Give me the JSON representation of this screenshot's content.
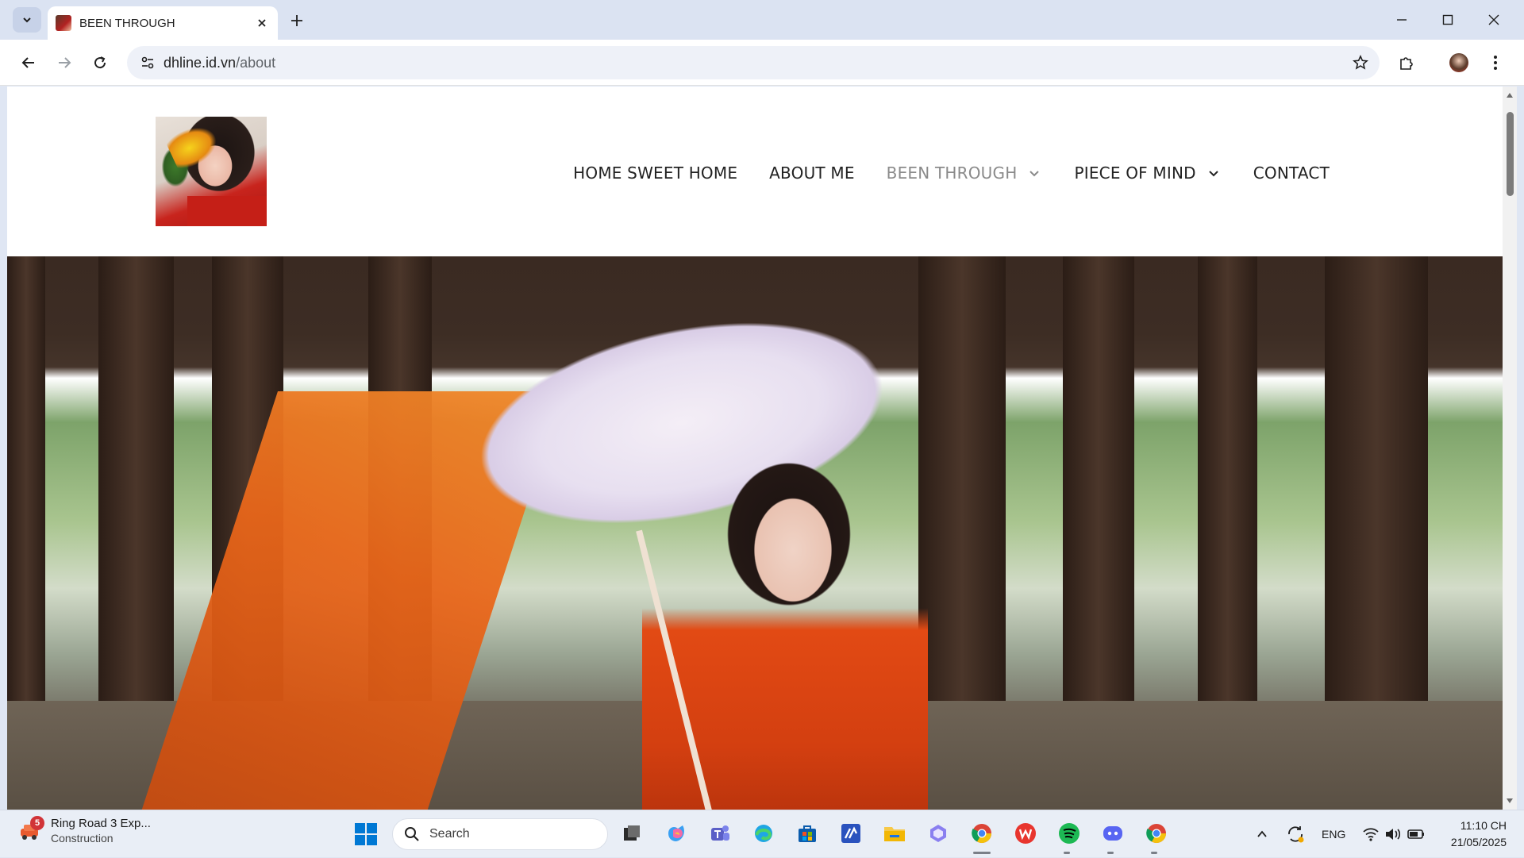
{
  "browser": {
    "tab": {
      "title": "BEEN THROUGH"
    },
    "address": {
      "host": "dhline.id.vn",
      "path": "/about"
    }
  },
  "site": {
    "nav": [
      {
        "label": "HOME SWEET HOME",
        "has_dropdown": false,
        "active": false
      },
      {
        "label": "ABOUT ME",
        "has_dropdown": false,
        "active": false
      },
      {
        "label": "BEEN THROUGH",
        "has_dropdown": true,
        "active": true
      },
      {
        "label": "PIECE OF MIND",
        "has_dropdown": true,
        "active": false
      },
      {
        "label": "CONTACT",
        "has_dropdown": false,
        "active": false
      }
    ]
  },
  "taskbar": {
    "widget": {
      "title": "Ring Road 3 Exp...",
      "subtitle": "Construction",
      "badge": "5"
    },
    "search_placeholder": "Search",
    "language": "ENG",
    "time": "11:10 CH",
    "date": "21/05/2025",
    "apps": [
      "task-view",
      "copilot",
      "teams",
      "edge",
      "store",
      "visual-studio",
      "file-explorer",
      "copilot-app",
      "chrome",
      "wps-office",
      "spotify",
      "discord",
      "chrome-profile"
    ]
  },
  "colors": {
    "nav_text": "#222222",
    "nav_active": "#8a8a8a",
    "chrome_bg": "#dbe3f2"
  }
}
